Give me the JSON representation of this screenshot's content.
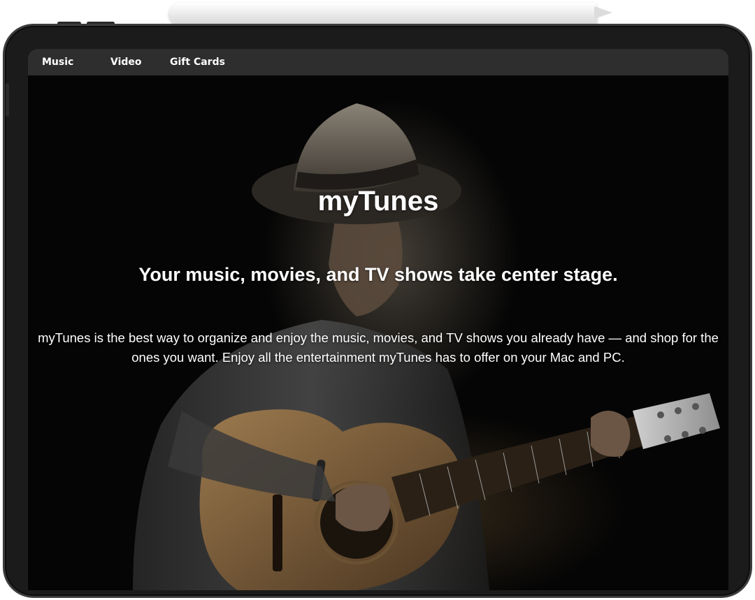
{
  "nav": {
    "items": [
      {
        "label": "Music"
      },
      {
        "label": "Video"
      },
      {
        "label": "Gift Cards"
      }
    ]
  },
  "hero": {
    "title": "myTunes",
    "subtitle": "Your music, movies, and TV shows take center stage.",
    "description": "myTunes is the best way to organize and enjoy the music, movies, and TV shows you already have — and shop for the ones you want. Enjoy all the entertainment myTunes has to offer on your Mac and PC.",
    "image": "guitarist-in-hat-photo"
  },
  "colors": {
    "nav_background": "#2e2e2e",
    "hero_background": "#050505",
    "text": "#ffffff",
    "device_frame": "#1b1b1b"
  }
}
